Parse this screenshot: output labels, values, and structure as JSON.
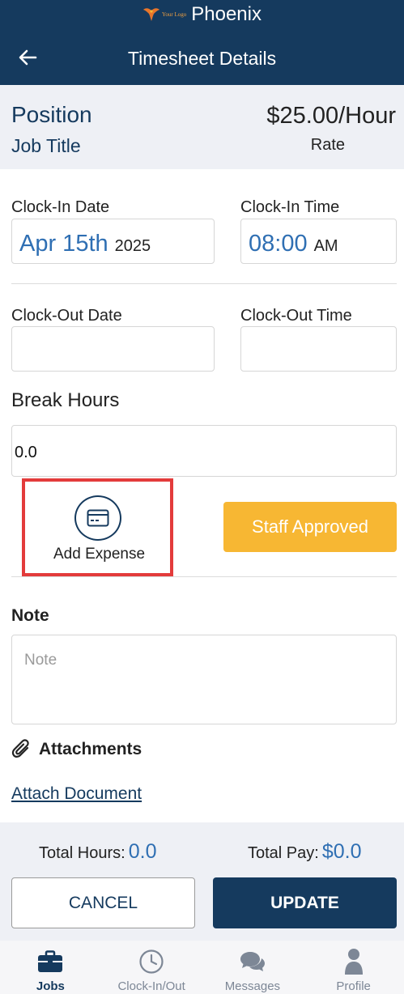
{
  "header": {
    "logo_text": "Your Logo",
    "app_name": "Phoenix",
    "title": "Timesheet Details",
    "back_icon": "arrow-left-icon"
  },
  "position": {
    "title": "Position",
    "job_title": "Job Title",
    "rate_value": "$25.00/Hour",
    "rate_label": "Rate"
  },
  "clock_in": {
    "date_label": "Clock-In Date",
    "date_main": "Apr 15th",
    "date_year": "2025",
    "time_label": "Clock-In Time",
    "time_main": "08:00",
    "time_period": "AM"
  },
  "clock_out": {
    "date_label": "Clock-Out Date",
    "date_value": "",
    "time_label": "Clock-Out Time",
    "time_value": ""
  },
  "break": {
    "label": "Break Hours",
    "value": "0.0"
  },
  "expense": {
    "label": "Add Expense",
    "icon": "credit-card-icon"
  },
  "status_button": {
    "label": "Staff Approved",
    "color": "#f7b733"
  },
  "note": {
    "label": "Note",
    "placeholder": "Note",
    "value": ""
  },
  "attachments": {
    "label": "Attachments",
    "icon": "paperclip-icon",
    "link_label": "Attach Document"
  },
  "totals": {
    "hours_label": "Total Hours:",
    "hours_value": "0.0",
    "pay_label": "Total Pay:",
    "pay_value": "$0.0"
  },
  "actions": {
    "cancel_label": "CANCEL",
    "update_label": "UPDATE"
  },
  "bottom_nav": {
    "items": [
      {
        "label": "Jobs",
        "icon": "briefcase-icon",
        "active": true
      },
      {
        "label": "Clock-In/Out",
        "icon": "clock-icon",
        "active": false
      },
      {
        "label": "Messages",
        "icon": "chat-bubbles-icon",
        "active": false
      },
      {
        "label": "Profile",
        "icon": "person-icon",
        "active": false
      }
    ]
  },
  "colors": {
    "primary": "#153a5e",
    "accent_blue": "#2f6fb3",
    "highlight_red": "#e33b3b",
    "approved_yellow": "#f7b733"
  }
}
